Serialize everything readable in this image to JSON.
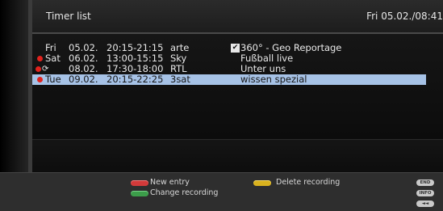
{
  "header": {
    "title": "Timer list",
    "clock": "Fri 05.02./08:41"
  },
  "timers": [
    {
      "day": "Fri",
      "date": "05.02.",
      "time": "20:15-21:15",
      "channel": "arte",
      "title": "360° - Geo Reportage",
      "recording": false,
      "repeat": false,
      "checked": true,
      "selected": false
    },
    {
      "day": "Sat",
      "date": "06.02.",
      "time": "13:00-15:15",
      "channel": "Sky",
      "title": "Fußball live",
      "recording": true,
      "repeat": false,
      "checked": false,
      "selected": false
    },
    {
      "day": "",
      "date": "08.02.",
      "time": "17:30-18:00",
      "channel": "RTL",
      "title": "Unter uns",
      "recording": true,
      "repeat": true,
      "checked": false,
      "selected": false
    },
    {
      "day": "Tue",
      "date": "09.02.",
      "time": "20:15-22:25",
      "channel": "3sat",
      "title": "wissen spezial",
      "recording": true,
      "repeat": false,
      "checked": false,
      "selected": true
    }
  ],
  "footer": {
    "new_entry": "New entry",
    "change_recording": "Change recording",
    "delete_recording": "Delete recording",
    "remote_end": "END",
    "remote_info": "INFO",
    "remote_rewind": "◄◄"
  },
  "colors": {
    "selection": "#a6c2e6",
    "record_dot": "#e2221d",
    "key_red": "#d23a3a",
    "key_green": "#3c9d4a",
    "key_yellow": "#d9b21e"
  },
  "icons": {
    "record": "record-dot-icon",
    "repeat": "repeat-icon",
    "check": "checkbox-checked-icon"
  }
}
